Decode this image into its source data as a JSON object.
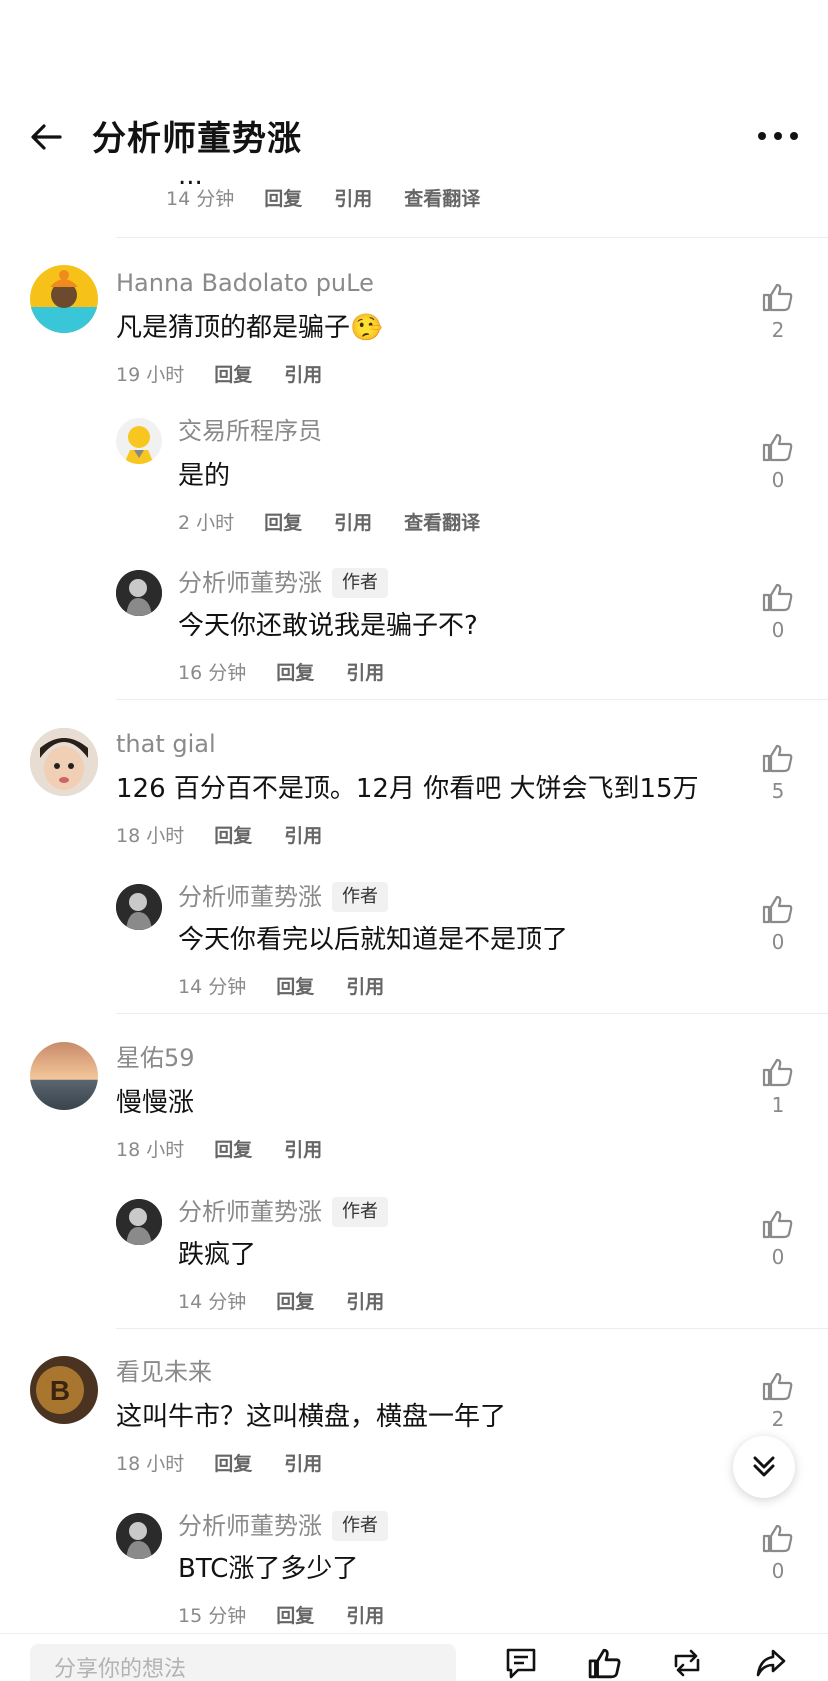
{
  "header": {
    "title": "分析师董势涨"
  },
  "clipped_text": "...",
  "actions": {
    "reply": "回复",
    "quote": "引用",
    "translate": "查看翻译"
  },
  "author_tag": "作者",
  "first_meta": {
    "time": "14 分钟"
  },
  "comments": [
    {
      "name": "Hanna Badolato puLe",
      "text": "凡是猜顶的都是骗子",
      "emoji": "🤥",
      "time": "19 小时",
      "likes": "2"
    },
    {
      "name": "交易所程序员",
      "text": "是的",
      "time": "2 小时",
      "likes": "0"
    },
    {
      "name": "分析师董势涨",
      "text": "今天你还敢说我是骗子不?",
      "time": "16 分钟",
      "likes": "0"
    },
    {
      "name": "that gial",
      "text": "126 百分百不是顶。12月 你看吧 大饼会飞到15万",
      "time": "18 小时",
      "likes": "5"
    },
    {
      "name": "分析师董势涨",
      "text": "今天你看完以后就知道是不是顶了",
      "time": "14 分钟",
      "likes": "0"
    },
    {
      "name": "星佑59",
      "text": "慢慢涨",
      "time": "18 小时",
      "likes": "1"
    },
    {
      "name": "分析师董势涨",
      "text": "跌疯了",
      "time": "14 分钟",
      "likes": "0"
    },
    {
      "name": "看见未来",
      "text": "这叫牛市？这叫横盘，横盘一年了",
      "time": "18 小时",
      "likes": "2"
    },
    {
      "name": "分析师董势涨",
      "text": "BTC涨了多少了",
      "time": "15 分钟",
      "likes": "0"
    }
  ],
  "input": {
    "placeholder": "分享你的想法"
  },
  "icons": [
    "back-arrow-icon",
    "more-icon",
    "thumb-up-icon",
    "double-chevron-down-icon",
    "comment-icon",
    "like-icon",
    "repost-icon",
    "share-icon"
  ]
}
